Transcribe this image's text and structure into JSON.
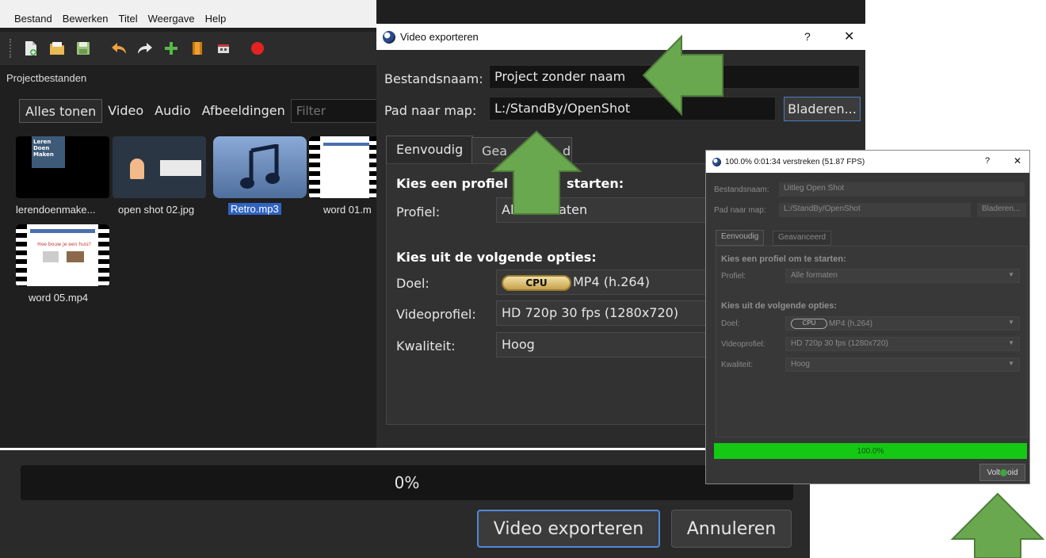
{
  "main": {
    "menu": [
      "Bestand",
      "Bewerken",
      "Titel",
      "Weergave",
      "Help"
    ],
    "toolbar_icons": [
      "new-project-icon",
      "open-project-icon",
      "save-project-icon",
      "undo-icon",
      "redo-icon",
      "import-files-icon",
      "profile-icon",
      "fullscreen-icon",
      "record-icon"
    ],
    "project_files_title": "Projectbestanden",
    "filter_tabs": [
      "Alles tonen",
      "Video",
      "Audio",
      "Afbeeldingen"
    ],
    "filter_placeholder": "Filter",
    "files": [
      {
        "name": "lerendoenmake...",
        "thumb_text": "Leren Doen Maken"
      },
      {
        "name": "open shot 02.jpg"
      },
      {
        "name": "Retro.mp3"
      },
      {
        "name": "word 01.m"
      },
      {
        "name": "word 05.mp4",
        "thumb_text": "Hoe bouw je een huis?"
      }
    ]
  },
  "bottom": {
    "progress": "0%",
    "export_button": "Video exporteren",
    "cancel_button": "Annuleren"
  },
  "dialog": {
    "title": "Video exporteren",
    "help_symbol": "?",
    "close_symbol": "✕",
    "filename_label": "Bestandsnaam:",
    "filename_value": "Project zonder naam",
    "folder_label": "Pad naar map:",
    "folder_value": "L:/StandBy/OpenShot",
    "browse_button": "Bladeren...",
    "tab_simple": "Eenvoudig",
    "tab_advanced_visible": "Gea",
    "tab_advanced_tail": "d",
    "profile_section_start": "Kies een profiel o",
    "profile_section_end": "starten:",
    "profile_label": "Profiel:",
    "profile_value": "Alle formaten",
    "options_section": "Kies uit de volgende opties:",
    "target_label": "Doel:",
    "target_badge": "CPU",
    "target_value": "MP4 (h.264)",
    "video_profile_label": "Videoprofiel:",
    "video_profile_value": "HD 720p 30 fps (1280x720)",
    "quality_label": "Kwaliteit:",
    "quality_value": "Hoog"
  },
  "progress_window": {
    "title": "100.0% 0:01:34 verstreken (51.87 FPS)",
    "help_symbol": "?",
    "close_symbol": "✕",
    "filename_label": "Bestandsnaam:",
    "filename_value": "Uitleg Open Shot",
    "folder_label": "Pad naar map:",
    "folder_value": "L:/StandBy/OpenShot",
    "browse_button": "Bladeren...",
    "tab_simple": "Eenvoudig",
    "tab_advanced": "Geavanceerd",
    "profile_section": "Kies een profiel om te starten:",
    "profile_label": "Profiel:",
    "profile_value": "Alle formaten",
    "options_section": "Kies uit de volgende opties:",
    "target_label": "Doel:",
    "target_badge": "CPU",
    "target_value": "MP4 (h.264)",
    "video_profile_label": "Videoprofiel:",
    "video_profile_value": "HD 720p 30 fps (1280x720)",
    "quality_label": "Kwaliteit:",
    "quality_value": "Hoog",
    "progress_text": "100.0%",
    "progress_fraction": 1.0,
    "done_button_start": "Volt",
    "done_button_end": "oid"
  },
  "colors": {
    "annotation_arrow": "#6aa84f",
    "progress_fill": "#14c814",
    "accent_border": "#4a7bc4"
  }
}
